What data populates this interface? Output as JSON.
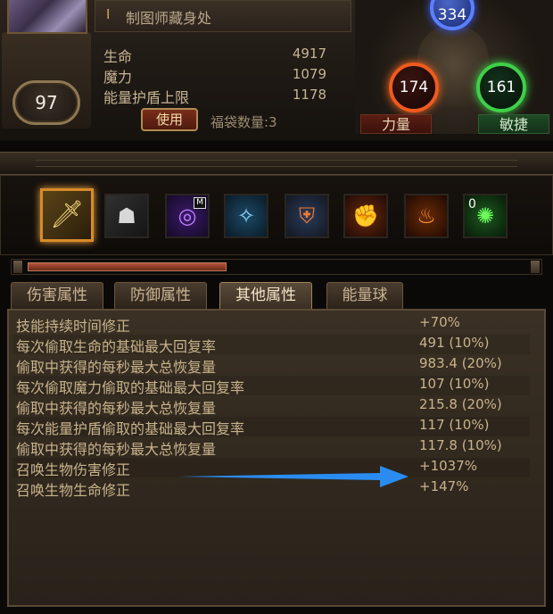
{
  "character": {
    "title": "制图师藏身处",
    "level": "97",
    "stats": [
      {
        "label": "生命",
        "value": "4917"
      },
      {
        "label": "魔力",
        "value": "1079"
      },
      {
        "label": "能量护盾上限",
        "value": "1178"
      }
    ],
    "use_button": "使用",
    "bag_count": "福袋数量:3"
  },
  "attributes": {
    "intelligence": "334",
    "strength": "174",
    "dexterity": "161",
    "strength_label": "力量",
    "dexterity_label": "敏捷"
  },
  "skills": [
    {
      "icon": "sword-icon",
      "glyph": "🗡",
      "selected": true
    },
    {
      "icon": "armored-figure-icon",
      "glyph": "☗"
    },
    {
      "icon": "purple-ring-icon",
      "glyph": "◎",
      "badge": "M"
    },
    {
      "icon": "blue-rune-icon",
      "glyph": "✧"
    },
    {
      "icon": "shield-strike-icon",
      "glyph": "⛨"
    },
    {
      "icon": "fire-fist-icon",
      "glyph": "✊"
    },
    {
      "icon": "fire-figure-icon",
      "glyph": "♨"
    },
    {
      "icon": "green-summon-icon",
      "glyph": "✺",
      "count": "0"
    }
  ],
  "progress": {
    "fill_fraction": 0.4
  },
  "tabs": [
    "伤害属性",
    "防御属性",
    "其他属性",
    "能量球"
  ],
  "active_tab": "其他属性",
  "rows": [
    {
      "label": "技能持续时间修正",
      "value": "+70%"
    },
    {
      "label": "每次偷取生命的基础最大回复率",
      "value": "491 (10%)"
    },
    {
      "label": "偷取中获得的每秒最大总恢复量",
      "value": "983.4 (20%)"
    },
    {
      "label": "每次偷取魔力偷取的基础最大回复率",
      "value": "107 (10%)"
    },
    {
      "label": "偷取中获得的每秒最大总恢复量",
      "value": "215.8 (20%)"
    },
    {
      "label": "每次能量护盾偷取的基础最大回复率",
      "value": "117 (10%)"
    },
    {
      "label": "偷取中获得的每秒最大总恢复量",
      "value": "117.8 (10%)"
    },
    {
      "label": "召唤生物伤害修正",
      "value": "+1037%"
    },
    {
      "label": "召唤生物生命修正",
      "value": "+147%"
    }
  ],
  "colors": {
    "arrow": "#2a8cf0",
    "intelligence_orb": "#5b80ff",
    "strength_orb": "#f05a1e",
    "dexterity_orb": "#3fd04a"
  }
}
